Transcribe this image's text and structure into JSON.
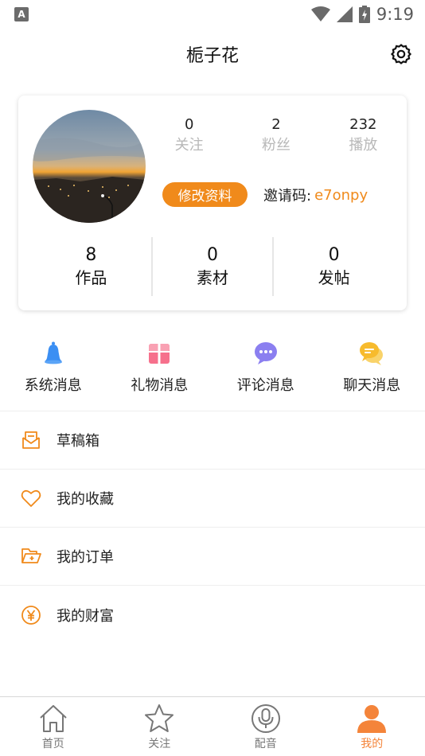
{
  "status_bar": {
    "left_icon_text": "A",
    "time": "9:19"
  },
  "header": {
    "title": "栀子花"
  },
  "profile": {
    "top_stats": [
      {
        "num": "0",
        "label": "关注"
      },
      {
        "num": "2",
        "label": "粉丝"
      },
      {
        "num": "232",
        "label": "播放"
      }
    ],
    "edit_label": "修改资料",
    "invite_label": "邀请码:",
    "invite_code": "e7onpy",
    "bottom_stats": [
      {
        "num": "8",
        "label": "作品"
      },
      {
        "num": "0",
        "label": "素材"
      },
      {
        "num": "0",
        "label": "发帖"
      }
    ]
  },
  "messages": [
    {
      "label": "系统消息",
      "icon": "bell-icon",
      "color": "#3b8ff3"
    },
    {
      "label": "礼物消息",
      "icon": "gift-icon",
      "color": "#f6708c"
    },
    {
      "label": "评论消息",
      "icon": "comment-icon",
      "color": "#8b7ff0"
    },
    {
      "label": "聊天消息",
      "icon": "chat-icon",
      "color": "#f7bb2d"
    }
  ],
  "menu": [
    {
      "label": "草稿箱",
      "icon": "draft-icon"
    },
    {
      "label": "我的收藏",
      "icon": "heart-icon"
    },
    {
      "label": "我的订单",
      "icon": "folder-icon"
    },
    {
      "label": "我的财富",
      "icon": "yen-icon"
    }
  ],
  "tabs": [
    {
      "label": "首页",
      "icon": "home-icon"
    },
    {
      "label": "关注",
      "icon": "star-icon"
    },
    {
      "label": "配音",
      "icon": "mic-icon"
    },
    {
      "label": "我的",
      "icon": "user-icon",
      "active": true
    }
  ],
  "colors": {
    "accent": "#f08a1b",
    "tab_active": "#f4843a"
  }
}
